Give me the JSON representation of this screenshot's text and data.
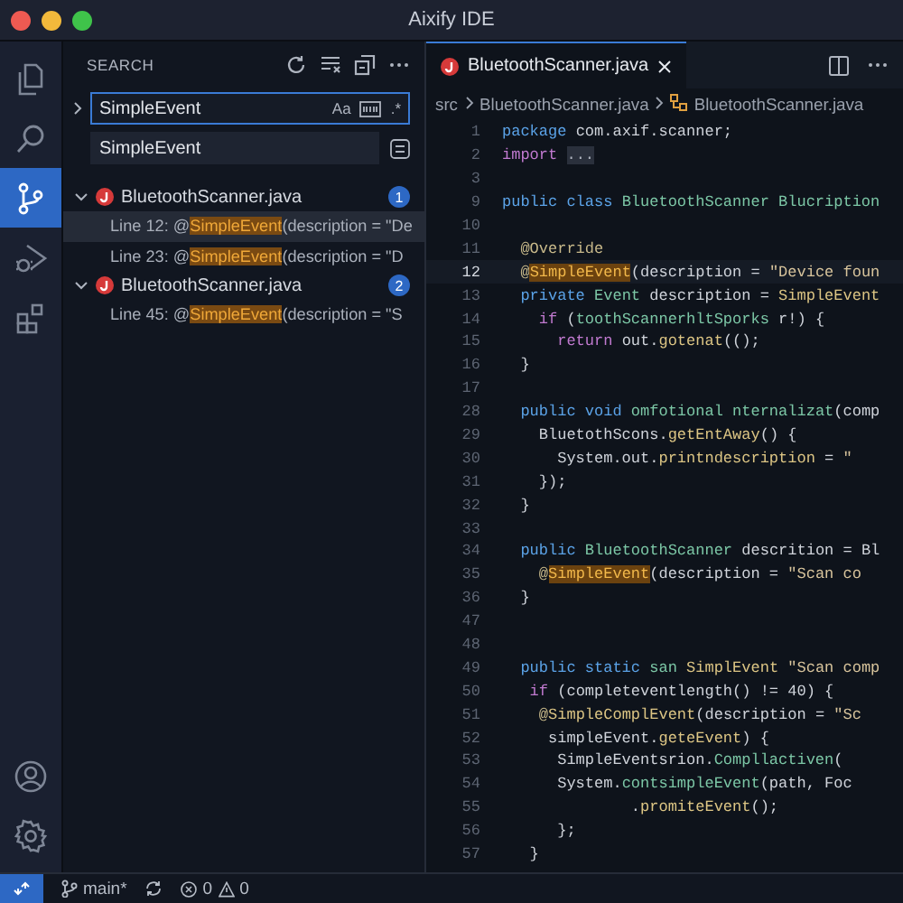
{
  "window": {
    "title": "Aixify IDE"
  },
  "activity_bar": {
    "items": [
      {
        "kind": "files",
        "selected": false
      },
      {
        "kind": "search",
        "selected": false
      },
      {
        "kind": "source-control",
        "selected": true
      },
      {
        "kind": "run-debug",
        "selected": false
      },
      {
        "kind": "extensions",
        "selected": false
      }
    ],
    "bottom": [
      {
        "kind": "account"
      },
      {
        "kind": "settings"
      }
    ]
  },
  "sidebar": {
    "title": "SEARCH",
    "actions": [
      {
        "kind": "refresh"
      },
      {
        "kind": "clear"
      },
      {
        "kind": "collapse"
      },
      {
        "kind": "more"
      }
    ],
    "search": {
      "value": "SimpleEvent",
      "toggles": [
        {
          "kind": "text",
          "label": "Aa"
        },
        {
          "kind": "word"
        },
        {
          "kind": "text",
          "label": ".*"
        }
      ]
    },
    "replace": {
      "value": "SimpleEvent"
    },
    "results": [
      {
        "file": "BluetoothScanner.java",
        "count": "1",
        "expanded": true,
        "children": [
          {
            "prefix": "Line 12: @",
            "match": "SimpleEvent",
            "suffix": "(description = \"De",
            "selected": true
          },
          {
            "prefix": "Line 23: @",
            "match": "SimpleEvent",
            "suffix": "(description = \"D",
            "selected": false
          }
        ]
      },
      {
        "file": "BluetoothScanner.java",
        "count": "2",
        "expanded": true,
        "children": [
          {
            "prefix": "Line 45: @",
            "match": "SimpleEvent",
            "suffix": "(description = \"S",
            "selected": false
          }
        ]
      }
    ]
  },
  "editor": {
    "tab": {
      "label": "BluetoothScanner.java"
    },
    "breadcrumb": [
      {
        "kind": "folder",
        "label": "src"
      },
      {
        "kind": "file",
        "label": "BluetoothScanner.java"
      },
      {
        "kind": "symbol",
        "label": "BluetoothScanner.java"
      }
    ],
    "lines": [
      {
        "num": "1",
        "current": false,
        "t": [
          {
            "kind": "kw",
            "text": "package"
          },
          {
            "kind": "p",
            "text": " com.axif.scanner;"
          }
        ]
      },
      {
        "num": "2",
        "current": false,
        "t": [
          {
            "kind": "kw2",
            "text": "import "
          },
          {
            "kind": "fold",
            "text": "..."
          }
        ]
      },
      {
        "num": "3",
        "current": false
      },
      {
        "num": "9",
        "current": false,
        "t": [
          {
            "kind": "kw",
            "text": "public class "
          },
          {
            "kind": "ty",
            "text": "BluetoothScanner Blucription"
          }
        ]
      },
      {
        "num": "10",
        "current": false
      },
      {
        "num": "11",
        "current": false,
        "t": [
          {
            "kind": "ann",
            "text": "  @Override"
          }
        ]
      },
      {
        "num": "12",
        "current": true,
        "t": [
          {
            "kind": "ann",
            "text": "  @"
          },
          {
            "kind": "hl",
            "text": "SimpleEvent"
          },
          {
            "kind": "p",
            "text": "(description = "
          },
          {
            "kind": "str",
            "text": "\"Device foun"
          }
        ]
      },
      {
        "num": "13",
        "current": false,
        "t": [
          {
            "kind": "kw",
            "text": "  private "
          },
          {
            "kind": "ty",
            "text": "Event"
          },
          {
            "kind": "p",
            "text": " description = "
          },
          {
            "kind": "fn",
            "text": "SimpleEvent"
          }
        ]
      },
      {
        "num": "14",
        "current": false,
        "t": [
          {
            "kind": "kw2",
            "text": "    if"
          },
          {
            "kind": "p",
            "text": " ("
          },
          {
            "kind": "ty",
            "text": "toothScannerhltSporks"
          },
          {
            "kind": "p",
            "text": " r!) {"
          }
        ]
      },
      {
        "num": "15",
        "current": false,
        "t": [
          {
            "kind": "kw2",
            "text": "      return"
          },
          {
            "kind": "p",
            "text": " out."
          },
          {
            "kind": "fn",
            "text": "gotenat"
          },
          {
            "kind": "p",
            "text": "(();"
          }
        ]
      },
      {
        "num": "16",
        "current": false,
        "t": [
          {
            "kind": "p",
            "text": "  }"
          }
        ]
      },
      {
        "num": "17",
        "current": false
      },
      {
        "num": "28",
        "current": false,
        "t": [
          {
            "kind": "kw",
            "text": "  public void "
          },
          {
            "kind": "ty",
            "text": "omfotional nternalizat"
          },
          {
            "kind": "p",
            "text": "(comp"
          }
        ]
      },
      {
        "num": "29",
        "current": false,
        "t": [
          {
            "kind": "p",
            "text": "    BluetothScons."
          },
          {
            "kind": "fn",
            "text": "getEntAway"
          },
          {
            "kind": "p",
            "text": "() {"
          }
        ]
      },
      {
        "num": "30",
        "current": false,
        "t": [
          {
            "kind": "p",
            "text": "      System.out."
          },
          {
            "kind": "fn",
            "text": "printndescription"
          },
          {
            "kind": "p",
            "text": " = "
          },
          {
            "kind": "str",
            "text": "\""
          }
        ]
      },
      {
        "num": "31",
        "current": false,
        "t": [
          {
            "kind": "p",
            "text": "    });"
          }
        ]
      },
      {
        "num": "32",
        "current": false,
        "t": [
          {
            "kind": "p",
            "text": "  }"
          }
        ]
      },
      {
        "num": "33",
        "current": false
      },
      {
        "num": "34",
        "current": false,
        "t": [
          {
            "kind": "kw",
            "text": "  public "
          },
          {
            "kind": "ty",
            "text": "BluetoothScanner"
          },
          {
            "kind": "p",
            "text": " descrition = Bl"
          }
        ]
      },
      {
        "num": "35",
        "current": false,
        "t": [
          {
            "kind": "ann",
            "text": "    @"
          },
          {
            "kind": "hl",
            "text": "SimpleEvent"
          },
          {
            "kind": "p",
            "text": "(description = "
          },
          {
            "kind": "str",
            "text": "\"Scan co"
          }
        ]
      },
      {
        "num": "36",
        "current": false,
        "t": [
          {
            "kind": "p",
            "text": "  }"
          }
        ]
      },
      {
        "num": "47",
        "current": false
      },
      {
        "num": "48",
        "current": false
      },
      {
        "num": "49",
        "current": false,
        "t": [
          {
            "kind": "kw",
            "text": "  public static "
          },
          {
            "kind": "ty",
            "text": "san "
          },
          {
            "kind": "fn",
            "text": "SimplEvent "
          },
          {
            "kind": "str",
            "text": "\"Scan comp"
          }
        ]
      },
      {
        "num": "50",
        "current": false,
        "t": [
          {
            "kind": "kw2",
            "text": "   if"
          },
          {
            "kind": "p",
            "text": " (completeventlength() != 40) {"
          }
        ]
      },
      {
        "num": "51",
        "current": false,
        "t": [
          {
            "kind": "ann",
            "text": "    @"
          },
          {
            "kind": "fn",
            "text": "SimpleComplEvent"
          },
          {
            "kind": "p",
            "text": "(description = "
          },
          {
            "kind": "str",
            "text": "\"Sc"
          }
        ]
      },
      {
        "num": "52",
        "current": false,
        "t": [
          {
            "kind": "p",
            "text": "     simpleEvent."
          },
          {
            "kind": "fn",
            "text": "geteEvent"
          },
          {
            "kind": "p",
            "text": ") {"
          }
        ]
      },
      {
        "num": "53",
        "current": false,
        "t": [
          {
            "kind": "p",
            "text": "      SimpleEventsrion."
          },
          {
            "kind": "ty",
            "text": "Compllactiven"
          },
          {
            "kind": "p",
            "text": "("
          }
        ]
      },
      {
        "num": "54",
        "current": false,
        "t": [
          {
            "kind": "p",
            "text": "      System."
          },
          {
            "kind": "ty",
            "text": "contsimpleEvent"
          },
          {
            "kind": "p",
            "text": "(path, Foc"
          }
        ]
      },
      {
        "num": "55",
        "current": false,
        "t": [
          {
            "kind": "p",
            "text": "              ."
          },
          {
            "kind": "fn",
            "text": "promiteEvent"
          },
          {
            "kind": "p",
            "text": "();"
          }
        ]
      },
      {
        "num": "56",
        "current": false,
        "t": [
          {
            "kind": "p",
            "text": "      };"
          }
        ]
      },
      {
        "num": "57",
        "current": false,
        "t": [
          {
            "kind": "p",
            "text": "   }"
          }
        ]
      }
    ]
  },
  "status_bar": {
    "branch": "main*",
    "errors": "0",
    "warnings": "0"
  }
}
